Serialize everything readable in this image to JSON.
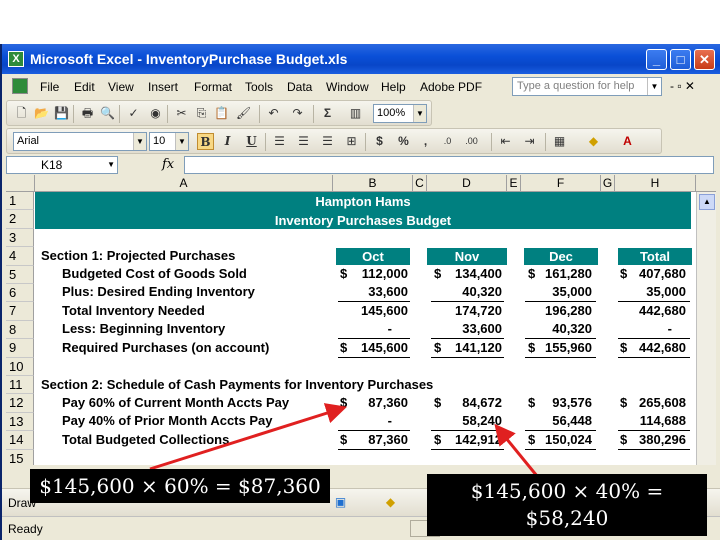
{
  "window": {
    "title": "Microsoft Excel - InventoryPurchase Budget.xls",
    "excel_icon_letter": "X",
    "controls": {
      "minimize": "_",
      "maximize": "□",
      "close": "✕"
    }
  },
  "menu": {
    "items": [
      "File",
      "Edit",
      "View",
      "Insert",
      "Format",
      "Tools",
      "Data",
      "Window",
      "Help",
      "Adobe PDF"
    ],
    "help_placeholder": "Type a question for help",
    "mdi_controls": "- ▫ ✕"
  },
  "standard_toolbar": {
    "zoom": "100%",
    "sum_symbol": "Σ"
  },
  "formatting_toolbar": {
    "font": "Arial",
    "size": "10",
    "bold": "B",
    "italic": "I",
    "underline": "U",
    "dollar": "$",
    "percent": "%",
    "comma": ","
  },
  "formula_bar": {
    "name_box": "K18",
    "fx": "fx",
    "content": ""
  },
  "columns": [
    "A",
    "B",
    "C",
    "D",
    "E",
    "F",
    "G",
    "H"
  ],
  "rows": [
    "1",
    "2",
    "3",
    "4",
    "5",
    "6",
    "7",
    "8",
    "9",
    "10",
    "11",
    "12",
    "13",
    "14",
    "15"
  ],
  "sheet": {
    "company": "Hampton Hams",
    "title": "Inventory Purchases Budget",
    "section1": "Section 1: Projected Purchases",
    "months": [
      "Oct",
      "Nov",
      "Dec",
      "Total"
    ],
    "s1_rows": [
      {
        "label": "Budgeted Cost of Goods Sold",
        "values": [
          "112,000",
          "134,400",
          "161,280",
          "407,680"
        ],
        "dollar": true
      },
      {
        "label": "Plus: Desired Ending Inventory",
        "values": [
          "33,600",
          "40,320",
          "35,000",
          "35,000"
        ],
        "dollar": false
      },
      {
        "label": "Total Inventory Needed",
        "values": [
          "145,600",
          "174,720",
          "196,280",
          "442,680"
        ],
        "dollar": false
      },
      {
        "label": "Less: Beginning Inventory",
        "values": [
          "-",
          "33,600",
          "40,320",
          "-"
        ],
        "dollar": false
      },
      {
        "label": "Required Purchases (on account)",
        "values": [
          "145,600",
          "141,120",
          "155,960",
          "442,680"
        ],
        "dollar": true
      }
    ],
    "section2": "Section 2: Schedule of Cash Payments for Inventory Purchases",
    "s2_rows": [
      {
        "label": "Pay 60% of Current Month Accts Pay",
        "values": [
          "87,360",
          "84,672",
          "93,576",
          "265,608"
        ],
        "dollar": true
      },
      {
        "label": "Pay 40% of Prior Month Accts Pay",
        "values": [
          "-",
          "58,240",
          "56,448",
          "114,688"
        ],
        "dollar": false
      },
      {
        "label": "Total Budgeted Collections",
        "values": [
          "87,360",
          "142,912",
          "150,024",
          "380,296"
        ],
        "dollar": true
      }
    ],
    "dollar_sign": "$"
  },
  "status": {
    "text": "Ready",
    "draw_label": "Draw"
  },
  "callouts": {
    "left": "$145,600 × 60% = $87,360",
    "right_line1": "$145,600 × 40% =",
    "right_line2": "$58,240"
  },
  "colors": {
    "teal": "#008080",
    "arrow_red": "#e02020",
    "titlebar_blue": "#0a50d8"
  }
}
